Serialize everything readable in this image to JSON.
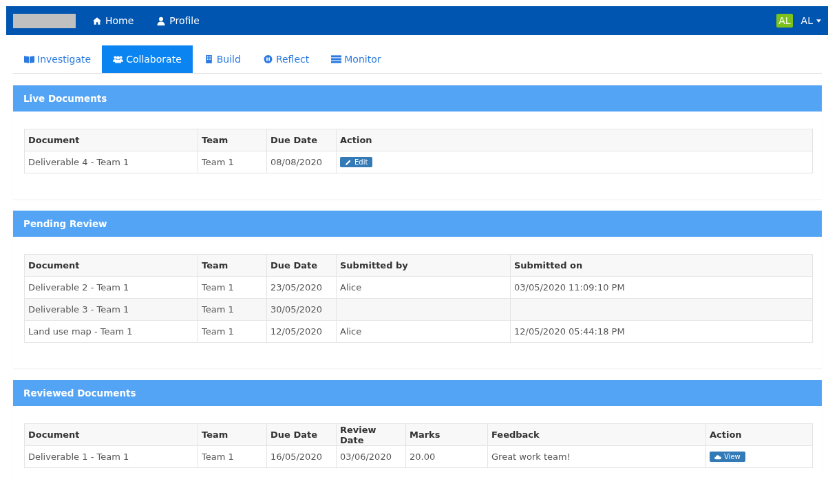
{
  "navbar": {
    "links": [
      {
        "label": "Home"
      },
      {
        "label": "Profile"
      }
    ],
    "avatar": "AL",
    "user_menu": "AL"
  },
  "tabs": [
    {
      "label": "Investigate",
      "selected": false
    },
    {
      "label": "Collaborate",
      "selected": true
    },
    {
      "label": "Build",
      "selected": false
    },
    {
      "label": "Reflect",
      "selected": false
    },
    {
      "label": "Monitor",
      "selected": false
    }
  ],
  "sections": [
    {
      "title": "Live Documents",
      "columns": [
        "Document",
        "Team",
        "Due Date",
        "Action"
      ],
      "rows": [
        [
          {
            "kind": "text",
            "text": "Deliverable 4 - Team 1"
          },
          {
            "kind": "text",
            "text": "Team 1"
          },
          {
            "kind": "text",
            "text": "08/08/2020"
          },
          {
            "kind": "edit",
            "label": "Edit"
          }
        ]
      ]
    },
    {
      "title": "Pending Review",
      "columns": [
        "Document",
        "Team",
        "Due Date",
        "Submitted by",
        "Submitted on"
      ],
      "rows": [
        [
          {
            "kind": "text",
            "text": "Deliverable 2 - Team 1"
          },
          {
            "kind": "text",
            "text": "Team 1"
          },
          {
            "kind": "text",
            "text": "23/05/2020"
          },
          {
            "kind": "text",
            "text": "Alice"
          },
          {
            "kind": "text",
            "text": "03/05/2020 11:09:10 PM"
          }
        ],
        [
          {
            "kind": "text",
            "text": "Deliverable 3 - Team 1"
          },
          {
            "kind": "text",
            "text": "Team 1"
          },
          {
            "kind": "text",
            "text": "30/05/2020"
          },
          {
            "kind": "empty"
          },
          {
            "kind": "empty"
          }
        ],
        [
          {
            "kind": "text",
            "text": "Land use map - Team 1"
          },
          {
            "kind": "text",
            "text": "Team 1"
          },
          {
            "kind": "text",
            "text": "12/05/2020"
          },
          {
            "kind": "text",
            "text": "Alice"
          },
          {
            "kind": "text",
            "text": "12/05/2020 05:44:18 PM"
          }
        ]
      ]
    },
    {
      "title": "Reviewed Documents",
      "columns": [
        "Document",
        "Team",
        "Due Date",
        "Review Date",
        "Marks",
        "Feedback",
        "Action"
      ],
      "rows": [
        [
          {
            "kind": "text",
            "text": "Deliverable 1 - Team 1"
          },
          {
            "kind": "text",
            "text": "Team 1"
          },
          {
            "kind": "text",
            "text": "16/05/2020"
          },
          {
            "kind": "text",
            "text": "03/06/2020"
          },
          {
            "kind": "text",
            "text": "20.00"
          },
          {
            "kind": "text",
            "text": "Great work team!"
          },
          {
            "kind": "view",
            "label": "View"
          }
        ]
      ]
    }
  ]
}
